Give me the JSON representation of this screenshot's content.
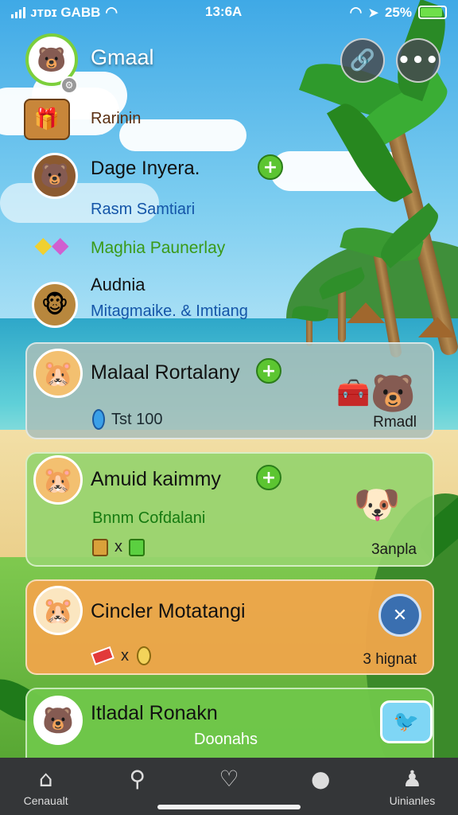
{
  "status_bar": {
    "carrier": "ᴊ ᴏ ᴛ ᴅ ɪ  GABB",
    "carrier_text": "\u0003\u0003\u0003\u0003",
    "time": "13:6A",
    "battery_percent": "25%",
    "battery_level": 0.9
  },
  "header": {
    "title": "Gmaal",
    "link_icon": "link-icon",
    "more_icon": "more-icon"
  },
  "feed": [
    {
      "label": "Rarinin",
      "icon": "chest-icon"
    },
    {
      "label": "Dage Inyera.",
      "icon": "bear-avatar"
    },
    {
      "label": "Rasm Samtiari"
    },
    {
      "label": "Maghia Paunerlay",
      "icon": "gems-icon"
    },
    {
      "label": "Audnia",
      "icon": "explorer-avatar"
    },
    {
      "label": "Mitagmaike. & Imtiang"
    }
  ],
  "cards": [
    {
      "name": "Malaal Rortalany",
      "gem_value": "Tst  100",
      "tag": "Rmadl",
      "color": "#b6c7c3"
    },
    {
      "name": "Amuid kaimmy",
      "subtitle": "Bnnm Cofdalani",
      "multiplier": "x",
      "tag": "3anpla",
      "color": "#97d46b"
    },
    {
      "name": "Cincler Motatangi",
      "multiplier": "x",
      "tag": "3 hignat",
      "color": "#eea64a"
    },
    {
      "name": "Itladal Ronakn",
      "subtitle": "Doonahs",
      "color": "#6fc74a"
    }
  ],
  "tabbar": {
    "tabs": [
      {
        "label": "Cenaualt",
        "icon": "home-icon"
      },
      {
        "label": "",
        "icon": "search-icon"
      },
      {
        "label": "",
        "icon": "heart-message-icon"
      },
      {
        "label": "",
        "icon": "chat-icon"
      },
      {
        "label": "Uinianles",
        "icon": "profile-icon"
      }
    ]
  },
  "colors": {
    "accent_green": "#5cc531",
    "card_gray": "#b6c7c3",
    "card_orange": "#eea64a",
    "tabbar": "#343638"
  }
}
